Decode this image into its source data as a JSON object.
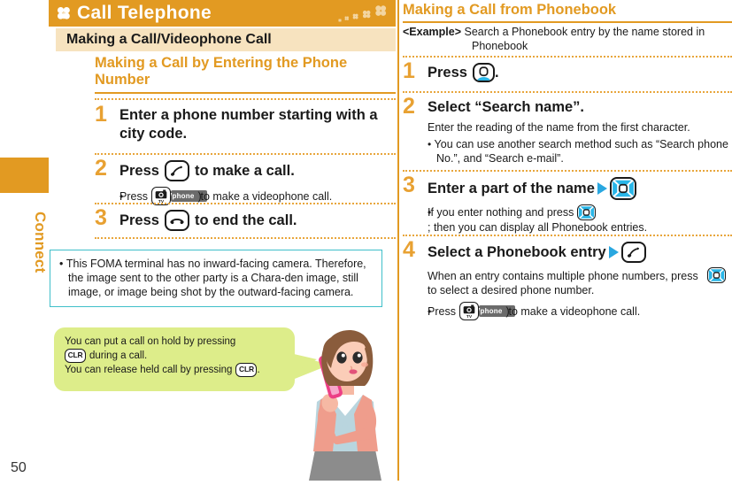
{
  "side": {
    "chapter_tab_label": "Connect",
    "page_number": "50",
    "tab_color": "#e29a22"
  },
  "left": {
    "chapter_title": "Call Telephone",
    "subhead": "Making a Call/Videophone Call",
    "section_title": "Making a Call by Entering the Phone Number",
    "steps": [
      {
        "num": "1",
        "head": "Enter a phone number starting with a city code."
      },
      {
        "num": "2",
        "head_before": "Press",
        "key": "call-key-icon",
        "head_after": "to make a call.",
        "bullet_before": "Press",
        "bullet_key": "camera-tv-key-icon",
        "bullet_paren_open": "(",
        "bullet_badge": "Vphone",
        "bullet_paren_close": ")",
        "bullet_after": "to make a videophone call."
      },
      {
        "num": "3",
        "head_before": "Press",
        "key": "end-call-key-icon",
        "head_after": "to end the call."
      }
    ],
    "note": "This FOMA terminal has no inward-facing camera. Therefore, the image sent to the other party is a Chara-den image, still image, or image being shot by the outward-facing camera.",
    "note_border_color": "#3fbfc9",
    "bubble": {
      "line1": "You can put a call on hold by pressing",
      "key1": "CLR",
      "line2": "during a call.",
      "line3": "You can release held call by pressing",
      "key2": "CLR",
      "line4": ".",
      "bg_color": "#dded8a"
    }
  },
  "right": {
    "title": "Making a Call from Phonebook",
    "example_label": "<Example>",
    "example_text": "Search a Phonebook entry by the name stored in",
    "example_text2": "Phonebook",
    "steps": [
      {
        "num": "1",
        "head_before": "Press",
        "key": "phonebook-key-icon",
        "head_after": "."
      },
      {
        "num": "2",
        "head": "Select “Search name”.",
        "sub": "Enter the reading of the name from the first character.",
        "bullet": "You can use another search method such as “Search phone No.”, and “Search e-mail”."
      },
      {
        "num": "3",
        "head_before": "Enter a part of the name",
        "arrow": "▶",
        "key": "select-nav-key-icon",
        "bullet_before": "If you enter nothing and press",
        "bullet_key": "select-nav-key-icon",
        "bullet_after": "; then you can display all Phonebook entries."
      },
      {
        "num": "4",
        "head_before": "Select a Phonebook entry",
        "arrow": "▶",
        "key": "call-key-icon",
        "sub_before": "When an entry contains multiple phone numbers, press",
        "sub_key": "select-nav-key-icon",
        "sub_after": "to select a desired phone number.",
        "bullet_before": "Press",
        "bullet_key": "camera-tv-key-icon",
        "bullet_paren_open": "(",
        "bullet_badge": "Vphone",
        "bullet_paren_close": ")",
        "bullet_after": "to make a videophone call."
      }
    ]
  },
  "colors": {
    "accent_orange": "#e29a22",
    "step_number": "#e8a132",
    "key_cyan": "#29b6e8",
    "note_teal": "#3fbfc9",
    "bubble_green": "#dded8a"
  }
}
